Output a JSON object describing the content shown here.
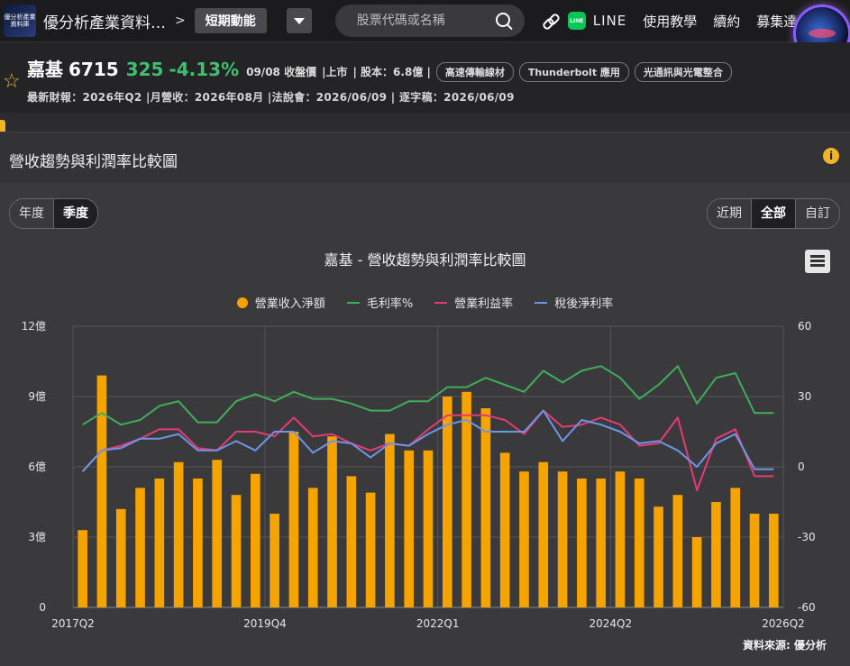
{
  "topbar": {
    "logo_text": "優分析產業資料庫",
    "site_title": "優分析產業資料…",
    "crumb_sep": ">",
    "crumb_label": "短期動能",
    "search_placeholder": "股票代碼或名稱",
    "line_label": "LINE",
    "nav": [
      "使用教學",
      "續約",
      "募集達人"
    ]
  },
  "stock": {
    "name": "嘉基",
    "code": "6715",
    "price": "325",
    "change": "-4.13%",
    "date_label": "09/08 收盤價",
    "market": "|上市",
    "capital": "| 股本：6.8億 |",
    "tags": [
      "高速傳輸線材",
      "Thunderbolt 應用",
      "光通訊與光電整合"
    ],
    "info_line": "最新財報：2026年Q2 |月營收：2026年08月 |法說會：2026/06/09 | 逐字稿：2026/06/09"
  },
  "panel": {
    "title": "營收趨勢與利潤率比較圖",
    "period_tabs": [
      "年度",
      "季度"
    ],
    "period_active": "季度",
    "range_tabs": [
      "近期",
      "全部",
      "自訂"
    ],
    "range_active": "全部",
    "source": "資料來源: 優分析"
  },
  "colors": {
    "revenue": "#f5a300",
    "gross": "#3fae5a",
    "operating": "#e23c73",
    "net": "#6f95e8",
    "positive": "#3fbf6f"
  },
  "chart_data": {
    "type": "bar",
    "title": "嘉基 - 營收趨勢與利潤率比較圖",
    "x_tick_labels": [
      "2017Q2",
      "2019Q4",
      "2022Q1",
      "2024Q2",
      "2026Q2"
    ],
    "left_axis": {
      "ticks": [
        "0",
        "3億",
        "6億",
        "9億",
        "12億"
      ],
      "range": [
        0,
        12
      ],
      "unit": "億"
    },
    "right_axis": {
      "ticks": [
        "-60",
        "-30",
        "0",
        "30",
        "60"
      ],
      "range": [
        -60,
        60
      ]
    },
    "categories": [
      "2017Q2",
      "2017Q3",
      "2017Q4",
      "2018Q1",
      "2018Q2",
      "2018Q3",
      "2018Q4",
      "2019Q1",
      "2019Q2",
      "2019Q3",
      "2019Q4",
      "2020Q1",
      "2020Q2",
      "2020Q3",
      "2020Q4",
      "2021Q1",
      "2021Q2",
      "2021Q3",
      "2021Q4",
      "2022Q1",
      "2022Q2",
      "2022Q3",
      "2022Q4",
      "2023Q1",
      "2023Q2",
      "2023Q3",
      "2023Q4",
      "2024Q1",
      "2024Q2",
      "2024Q3",
      "2024Q4",
      "2025Q1",
      "2025Q2",
      "2025Q3",
      "2025Q4",
      "2026Q1",
      "2026Q2"
    ],
    "series": [
      {
        "name": "營業收入淨額",
        "axis": "left",
        "kind": "bar",
        "values": [
          3.3,
          9.9,
          4.2,
          5.1,
          5.5,
          6.2,
          5.5,
          6.3,
          4.8,
          5.7,
          4.0,
          7.5,
          5.1,
          7.3,
          5.6,
          4.9,
          7.4,
          6.7,
          6.7,
          9.0,
          9.2,
          8.5,
          6.6,
          5.8,
          6.2,
          5.8,
          5.5,
          5.5,
          5.8,
          5.5,
          4.3,
          4.8,
          3.0,
          4.5,
          5.1,
          4.0,
          4.0
        ]
      },
      {
        "name": "毛利率%",
        "axis": "right",
        "kind": "line",
        "values": [
          18,
          23,
          18,
          20,
          26,
          28,
          19,
          19,
          28,
          31,
          28,
          32,
          29,
          29,
          27,
          24,
          24,
          28,
          28,
          34,
          34,
          38,
          35,
          32,
          41,
          36,
          41,
          43,
          38,
          29,
          35,
          43,
          27,
          38,
          40,
          23,
          23
        ]
      },
      {
        "name": "營業利益率",
        "axis": "right",
        "kind": "line",
        "values": [
          -2,
          7,
          9,
          12,
          16,
          16,
          8,
          7,
          15,
          15,
          13,
          21,
          13,
          14,
          10,
          7,
          10,
          9,
          16,
          22,
          22,
          22,
          20,
          14,
          24,
          17,
          18,
          21,
          18,
          9,
          10,
          21,
          -10,
          12,
          16,
          -4,
          -4
        ]
      },
      {
        "name": "稅後淨利率",
        "axis": "right",
        "kind": "line",
        "values": [
          -2,
          7,
          8,
          12,
          12,
          14,
          7,
          7,
          11,
          7,
          15,
          15,
          6,
          11,
          10,
          4,
          10,
          9,
          14,
          18,
          20,
          15,
          15,
          15,
          24,
          11,
          20,
          18,
          15,
          10,
          11,
          7,
          0,
          10,
          14,
          -1,
          -1
        ]
      }
    ],
    "legend_position": "top",
    "grid": true
  }
}
